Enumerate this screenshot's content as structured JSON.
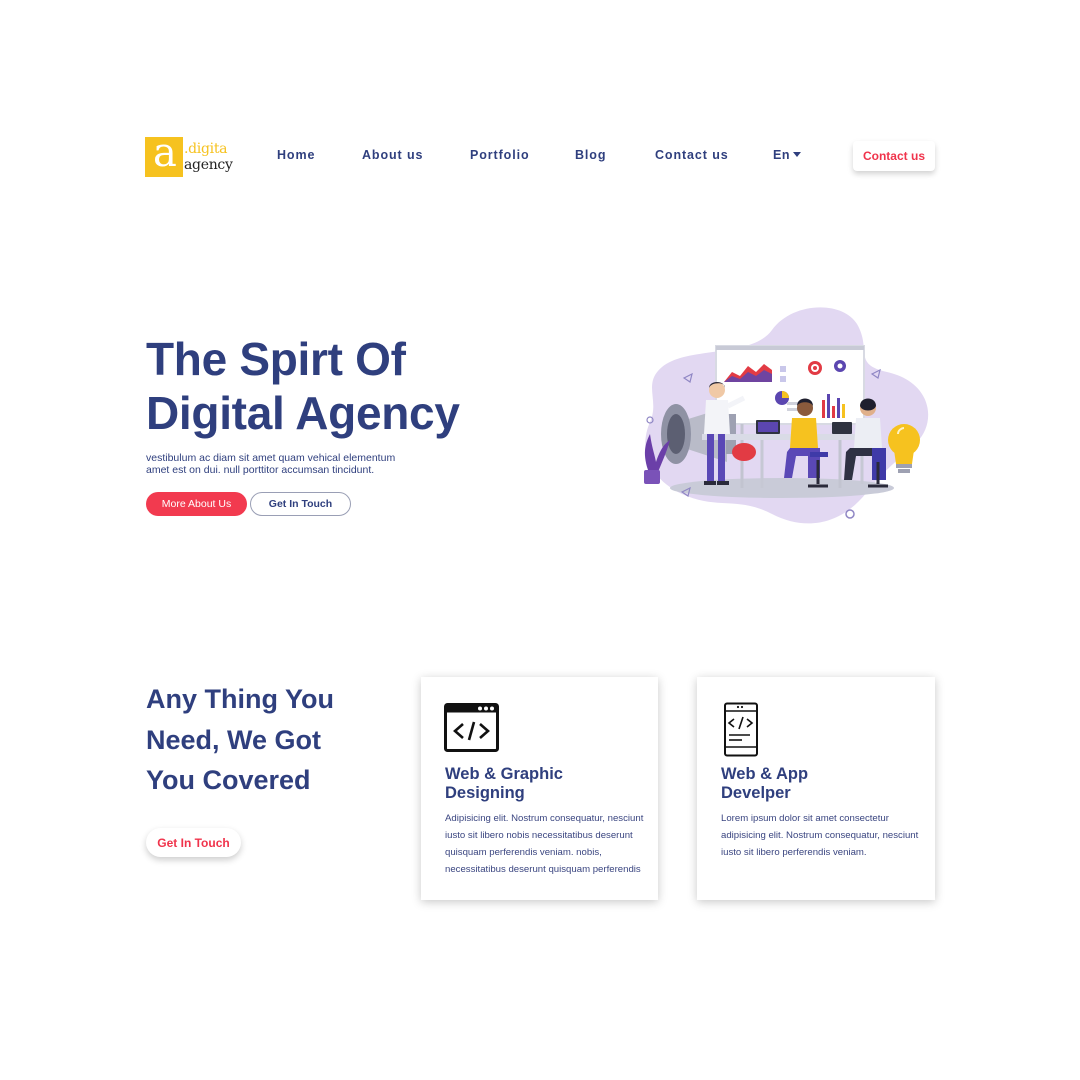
{
  "header": {
    "logo": {
      "line1": ".digita",
      "line2": "agency",
      "mark": "a"
    },
    "nav": [
      {
        "label": "Home"
      },
      {
        "label": "About us"
      },
      {
        "label": "Portfolio"
      },
      {
        "label": "Blog"
      },
      {
        "label": "Contact us"
      }
    ],
    "language": "En",
    "contact_button": "Contact us"
  },
  "hero": {
    "title_line1": "The Spirt Of",
    "title_line2": "Digital Agency",
    "description": "vestibulum ac diam sit amet quam vehical elementum amet est on dui. null porttitor accumsan tincidunt.",
    "primary_button": "More About Us",
    "secondary_button": "Get In Touch",
    "illustration_icon": "team-meeting-illustration"
  },
  "services": {
    "title_line1": "Any Thing You",
    "title_line2": "Need, We Got",
    "title_line3": "You Covered",
    "button": "Get In Touch",
    "cards": [
      {
        "icon": "browser-code-icon",
        "title_line1": "Web & Graphic",
        "title_line2": "Designing",
        "body": "Adipisicing elit. Nostrum consequatur, nesciunt iusto sit libero nobis necessitatibus deserunt quisquam perferendis veniam. nobis, necessitatibus deserunt quisquam perferendis"
      },
      {
        "icon": "mobile-code-icon",
        "title_line1": "Web & App",
        "title_line2": "Develper",
        "body": "Lorem ipsum dolor sit amet consectetur adipisicing elit. Nostrum consequatur, nesciunt iusto sit libero perferendis veniam."
      }
    ]
  },
  "colors": {
    "primary_text": "#2f3f7e",
    "accent_red": "#f23a4f",
    "logo_yellow": "#f6c21f",
    "blob_lavender": "#e2d8f2"
  }
}
